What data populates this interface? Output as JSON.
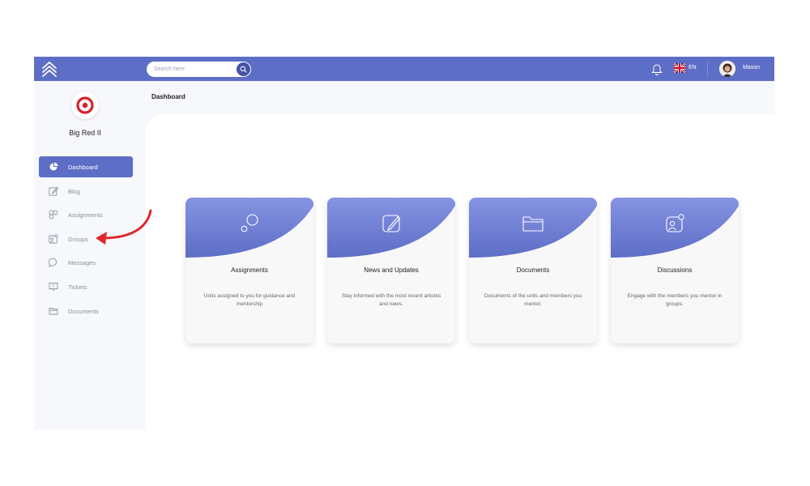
{
  "header": {
    "search_placeholder": "Search here",
    "language": "EN",
    "user_name": "Mason",
    "accent_color": "#5d6ec6"
  },
  "sidebar": {
    "brand_name": "Big Red II",
    "items": [
      {
        "label": "Dashboard",
        "icon": "pie-chart-icon",
        "active": true
      },
      {
        "label": "Blog",
        "icon": "edit-icon",
        "active": false
      },
      {
        "label": "Assignments",
        "icon": "circles-icon",
        "active": false
      },
      {
        "label": "Groups",
        "icon": "group-icon",
        "active": false
      },
      {
        "label": "Messages",
        "icon": "chat-bubble-icon",
        "active": false
      },
      {
        "label": "Tickets",
        "icon": "ticket-icon",
        "active": false
      },
      {
        "label": "Documents",
        "icon": "folder-icon",
        "active": false
      }
    ]
  },
  "main": {
    "breadcrumb": "Dashboard",
    "cards": [
      {
        "title": "Assignments",
        "description": "Units assigned to you for guidance and mentorship",
        "icon": "circles-icon"
      },
      {
        "title": "News and Updates",
        "description": "Stay informed with the most recent articles and news.",
        "icon": "edit-icon"
      },
      {
        "title": "Documents",
        "description": "Documents of the units and members you mentor.",
        "icon": "folder-icon"
      },
      {
        "title": "Discussions",
        "description": "Engage with the members you mentor in groups.",
        "icon": "group-icon"
      }
    ]
  }
}
